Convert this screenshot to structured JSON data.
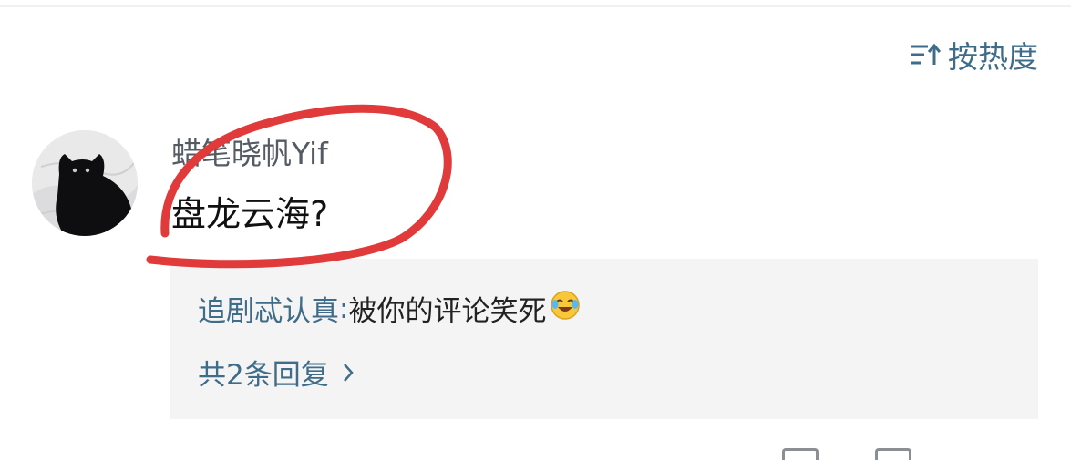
{
  "sort": {
    "label": "按热度",
    "icon": "sort-icon"
  },
  "comment": {
    "username": "蜡笔晓帆Yif",
    "text": "盘龙云海?",
    "avatar_icon": "black-cat-avatar"
  },
  "reply_preview": {
    "author": "追剧忒认真",
    "separator": ": ",
    "content": "被你的评论笑死",
    "emoji": "laughing-crying-emoji"
  },
  "reply_count_label": "共2条回复",
  "colors": {
    "link_blue": "#3f6c88",
    "annotation_red": "#e03a3a",
    "reply_bg": "#f4f4f5"
  }
}
